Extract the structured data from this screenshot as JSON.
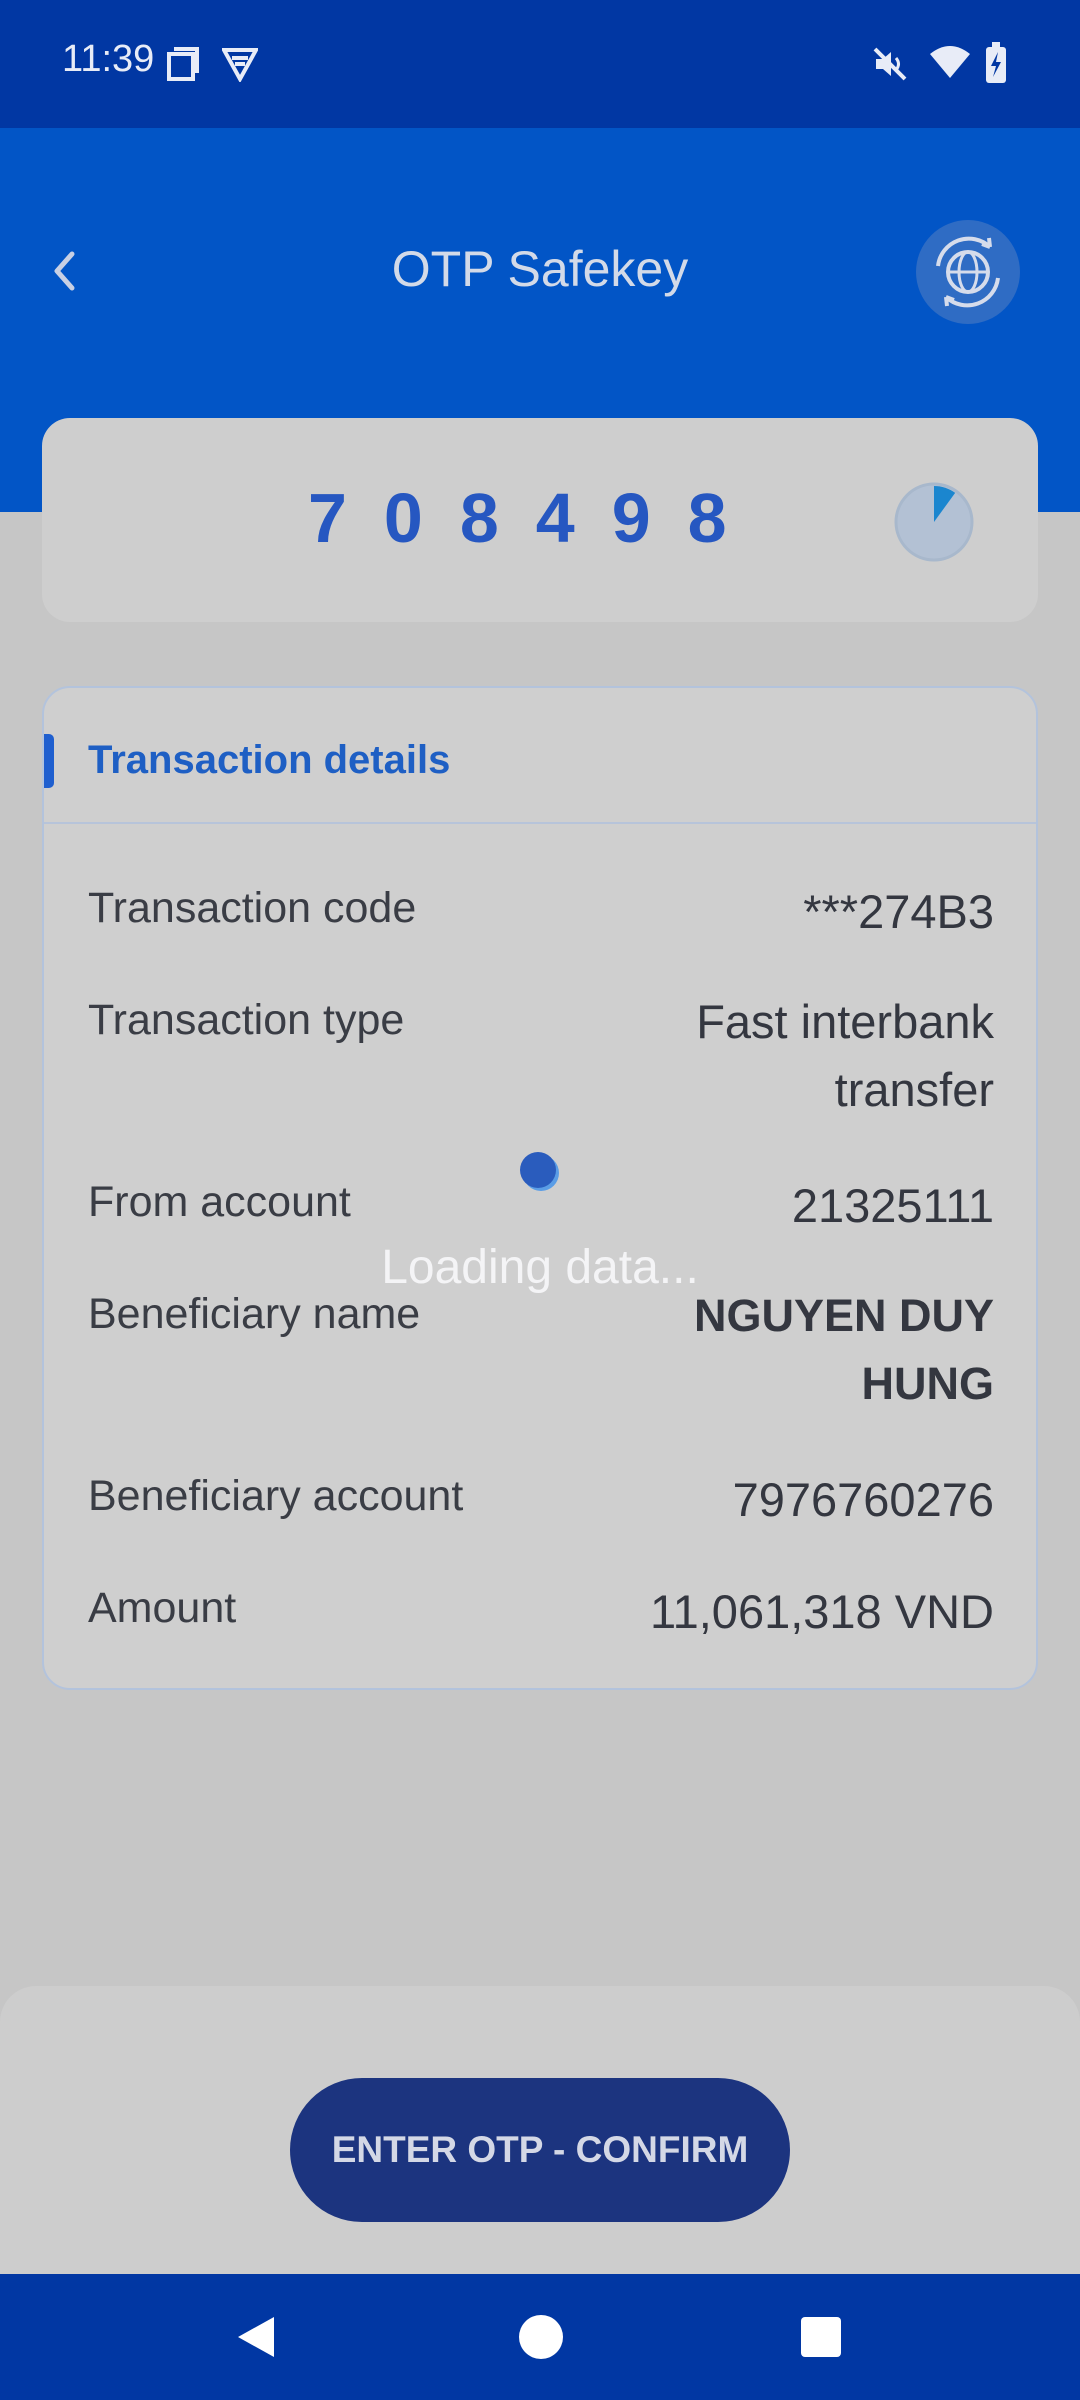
{
  "status_bar": {
    "time": "11:39",
    "icons_left": [
      "screenshot-icon",
      "vpn-shield-icon"
    ],
    "icons_right": [
      "mute-icon",
      "wifi-icon",
      "battery-charging-icon"
    ]
  },
  "header": {
    "title": "OTP Safekey",
    "back_icon": "chevron-left-icon",
    "action_icon": "globe-refresh-icon"
  },
  "otp": {
    "code": "708498",
    "timer_remaining_fraction": 0.9
  },
  "details": {
    "title": "Transaction details",
    "rows": [
      {
        "label": "Transaction code",
        "value": "***274B3"
      },
      {
        "label": "Transaction type",
        "value_line1": "Fast interbank",
        "value_line2": "transfer"
      },
      {
        "label": "From account",
        "value": "21325111"
      },
      {
        "label": "Beneficiary name",
        "value_line1": "NGUYEN DUY",
        "value_line2": "HUNG"
      },
      {
        "label": "Beneficiary account",
        "value": "7976760276"
      },
      {
        "label": "Amount",
        "value": "11,061,318 VND"
      }
    ]
  },
  "loading": {
    "text": "Loading data..."
  },
  "confirm_button": {
    "label": "ENTER OTP - CONFIRM"
  },
  "nav": {
    "icons": [
      "nav-back-icon",
      "nav-home-icon",
      "nav-recents-icon"
    ]
  },
  "colors": {
    "primary": "#0255c6",
    "status_bar": "#0137a3",
    "otp_digits": "#2657c1",
    "button": "#1c347f"
  }
}
